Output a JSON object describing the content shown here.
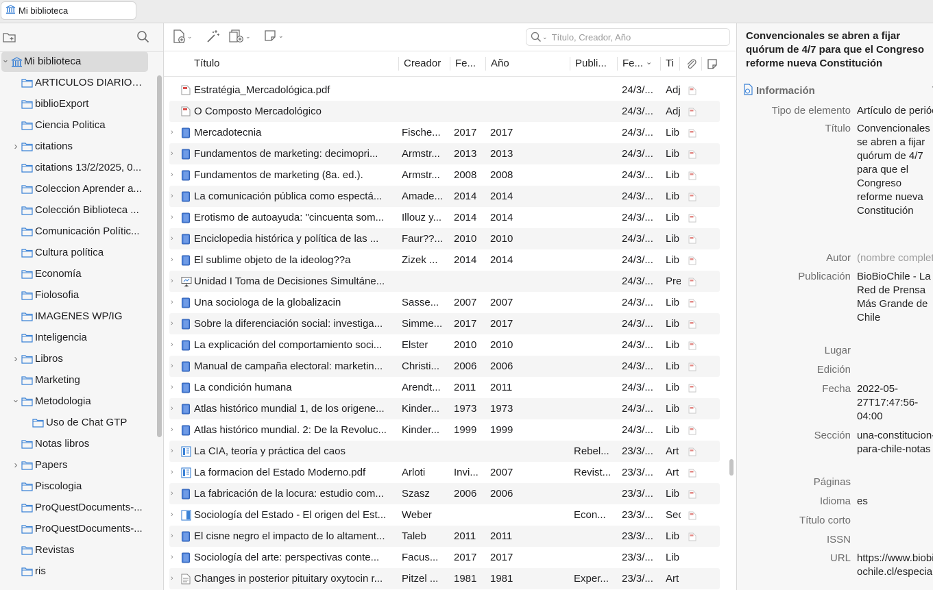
{
  "tab": {
    "title": "Mi biblioteca"
  },
  "left": {
    "items": [
      {
        "label": "Mi biblioteca",
        "kind": "library",
        "expanded": true,
        "selected": true
      },
      {
        "label": "ARTICULOS DIARIOS ...",
        "kind": "folder"
      },
      {
        "label": "biblioExport",
        "kind": "folder"
      },
      {
        "label": "Ciencia Politica",
        "kind": "folder"
      },
      {
        "label": "citations",
        "kind": "folder",
        "collapsed": true
      },
      {
        "label": "citations 13/2/2025, 0...",
        "kind": "folder"
      },
      {
        "label": "Coleccion Aprender a...",
        "kind": "folder"
      },
      {
        "label": "Colección Biblioteca ...",
        "kind": "folder"
      },
      {
        "label": "Comunicación Polític...",
        "kind": "folder"
      },
      {
        "label": "Cultura política",
        "kind": "folder"
      },
      {
        "label": "Economía",
        "kind": "folder"
      },
      {
        "label": "Fiolosofia",
        "kind": "folder"
      },
      {
        "label": "IMAGENES WP/IG",
        "kind": "folder"
      },
      {
        "label": "Inteligencia",
        "kind": "folder"
      },
      {
        "label": "Libros",
        "kind": "folder",
        "collapsed": true
      },
      {
        "label": "Marketing",
        "kind": "folder"
      },
      {
        "label": "Metodologia",
        "kind": "folder",
        "expanded": true
      },
      {
        "label": "Uso de Chat GTP",
        "kind": "folder",
        "child": true
      },
      {
        "label": "Notas libros",
        "kind": "folder"
      },
      {
        "label": "Papers",
        "kind": "folder",
        "collapsed": true
      },
      {
        "label": "Piscologia",
        "kind": "folder"
      },
      {
        "label": "ProQuestDocuments-...",
        "kind": "folder"
      },
      {
        "label": "ProQuestDocuments-...",
        "kind": "folder"
      },
      {
        "label": "Revistas",
        "kind": "folder"
      },
      {
        "label": "ris",
        "kind": "folder"
      }
    ]
  },
  "search": {
    "placeholder": "Título, Creador, Año"
  },
  "columns": {
    "title": "Título",
    "creator": "Creador",
    "fe1": "Fe...",
    "year": "Año",
    "pub": "Publi...",
    "fe2": "Fe...",
    "type": "Ti"
  },
  "rows": [
    {
      "title": "Estratégia_Mercadológica.pdf",
      "creator": "",
      "fe": "",
      "year": "",
      "pub": "",
      "added": "24/3/...",
      "type": "Adj",
      "icon": "pdf",
      "expandable": false,
      "attach": true
    },
    {
      "title": "O Composto Mercadológico",
      "creator": "",
      "fe": "",
      "year": "",
      "pub": "",
      "added": "24/3/...",
      "type": "Adj",
      "icon": "pdf",
      "expandable": false,
      "attach": true
    },
    {
      "title": "Mercadotecnia",
      "creator": "Fische...",
      "fe": "2017",
      "year": "2017",
      "pub": "",
      "added": "24/3/...",
      "type": "Lib",
      "icon": "book",
      "expandable": true,
      "attach": true
    },
    {
      "title": "Fundamentos de marketing: decimopri...",
      "creator": "Armstr...",
      "fe": "2013",
      "year": "2013",
      "pub": "",
      "added": "24/3/...",
      "type": "Lib",
      "icon": "book",
      "expandable": true,
      "attach": true
    },
    {
      "title": "Fundamentos de marketing (8a. ed.).",
      "creator": "Armstr...",
      "fe": "2008",
      "year": "2008",
      "pub": "",
      "added": "24/3/...",
      "type": "Lib",
      "icon": "book",
      "expandable": true,
      "attach": true
    },
    {
      "title": "La comunicación pública como espectá...",
      "creator": "Amade...",
      "fe": "2014",
      "year": "2014",
      "pub": "",
      "added": "24/3/...",
      "type": "Lib",
      "icon": "book",
      "expandable": true,
      "attach": true
    },
    {
      "title": "Erotismo de autoayuda: \"cincuenta som...",
      "creator": "Illouz y...",
      "fe": "2014",
      "year": "2014",
      "pub": "",
      "added": "24/3/...",
      "type": "Lib",
      "icon": "book",
      "expandable": true,
      "attach": true
    },
    {
      "title": "Enciclopedia histórica y política de las ...",
      "creator": "Faur??...",
      "fe": "2010",
      "year": "2010",
      "pub": "",
      "added": "24/3/...",
      "type": "Lib",
      "icon": "book",
      "expandable": true,
      "attach": true
    },
    {
      "title": "El sublime objeto de la ideolog??a",
      "creator": "Zizek ...",
      "fe": "2014",
      "year": "2014",
      "pub": "",
      "added": "24/3/...",
      "type": "Lib",
      "icon": "book",
      "expandable": true,
      "attach": true
    },
    {
      "title": "Unidad I Toma de Decisiones Simultáne...",
      "creator": "",
      "fe": "",
      "year": "",
      "pub": "",
      "added": "24/3/...",
      "type": "Pre",
      "icon": "presentation",
      "expandable": true,
      "attach": true
    },
    {
      "title": "Una sociologa de la globalizacin",
      "creator": "Sasse...",
      "fe": "2007",
      "year": "2007",
      "pub": "",
      "added": "24/3/...",
      "type": "Lib",
      "icon": "book",
      "expandable": true,
      "attach": true
    },
    {
      "title": "Sobre la diferenciación social: investiga...",
      "creator": "Simme...",
      "fe": "2017",
      "year": "2017",
      "pub": "",
      "added": "24/3/...",
      "type": "Lib",
      "icon": "book",
      "expandable": true,
      "attach": true
    },
    {
      "title": "La explicación del comportamiento soci...",
      "creator": "Elster",
      "fe": "2010",
      "year": "2010",
      "pub": "",
      "added": "24/3/...",
      "type": "Lib",
      "icon": "book",
      "expandable": true,
      "attach": true
    },
    {
      "title": "Manual de campaña electoral: marketin...",
      "creator": "Christi...",
      "fe": "2006",
      "year": "2006",
      "pub": "",
      "added": "24/3/...",
      "type": "Lib",
      "icon": "book",
      "expandable": true,
      "attach": true
    },
    {
      "title": "La condición humana",
      "creator": "Arendt...",
      "fe": "2011",
      "year": "2011",
      "pub": "",
      "added": "24/3/...",
      "type": "Lib",
      "icon": "book",
      "expandable": true,
      "attach": true
    },
    {
      "title": "Atlas histórico mundial 1, de los origene...",
      "creator": "Kinder...",
      "fe": "1973",
      "year": "1973",
      "pub": "",
      "added": "24/3/...",
      "type": "Lib",
      "icon": "book",
      "expandable": true,
      "attach": true
    },
    {
      "title": "Atlas histórico mundial. 2: De la Revoluc...",
      "creator": "Kinder...",
      "fe": "1999",
      "year": "1999",
      "pub": "",
      "added": "24/3/...",
      "type": "Lib",
      "icon": "book",
      "expandable": true,
      "attach": true
    },
    {
      "title": "La CIA, teoría y práctica del caos",
      "creator": "",
      "fe": "",
      "year": "",
      "pub": "Rebel...",
      "added": "23/3/...",
      "type": "Art",
      "icon": "journal",
      "expandable": true,
      "attach": true
    },
    {
      "title": "La formacion del Estado Moderno.pdf",
      "creator": "Arloti",
      "fe": "Invi...",
      "year": "2007",
      "pub": "Revist...",
      "added": "23/3/...",
      "type": "Art",
      "icon": "journal",
      "expandable": true,
      "attach": true
    },
    {
      "title": "La fabricación de la locura: estudio com...",
      "creator": "Szasz",
      "fe": "2006",
      "year": "2006",
      "pub": "",
      "added": "23/3/...",
      "type": "Lib",
      "icon": "book",
      "expandable": true,
      "attach": true
    },
    {
      "title": "Sociología del Estado - El origen del Est...",
      "creator": "Weber",
      "fe": "",
      "year": "",
      "pub": "Econ...",
      "added": "23/3/...",
      "type": "Sec",
      "icon": "booksection",
      "expandable": true,
      "attach": true
    },
    {
      "title": "El cisne negro el impacto de lo altament...",
      "creator": "Taleb",
      "fe": "2011",
      "year": "2011",
      "pub": "",
      "added": "23/3/...",
      "type": "Lib",
      "icon": "book",
      "expandable": true,
      "attach": true
    },
    {
      "title": "Sociología del arte: perspectivas conte...",
      "creator": "Facus...",
      "fe": "2017",
      "year": "2017",
      "pub": "",
      "added": "23/3/...",
      "type": "Lib",
      "icon": "book",
      "expandable": true,
      "attach": false
    },
    {
      "title": "Changes in posterior pituitary oxytocin r...",
      "creator": "Pitzel ...",
      "fe": "1981",
      "year": "1981",
      "pub": "Exper...",
      "added": "23/3/...",
      "type": "Art",
      "icon": "doc",
      "expandable": true,
      "attach": false
    }
  ],
  "right": {
    "title": "Convencionales se abren a fijar quórum de 4/7 para que el Congreso reforme nueva Constitución",
    "section": "Información",
    "fields": [
      {
        "label": "Tipo de elemento",
        "value": "Artículo de periódico"
      },
      {
        "label": "Título",
        "value": "Convencionales se abren a fijar quórum de 4/7 para que el Congreso reforme nueva Constitución"
      },
      {
        "label": "Autor",
        "value": "(nombre completo)"
      },
      {
        "label": "Publicación",
        "value": "BioBioChile - La Red de Prensa Más Grande de Chile"
      },
      {
        "label": "Lugar",
        "value": ""
      },
      {
        "label": "Edición",
        "value": ""
      },
      {
        "label": "Fecha",
        "value": "2022-05-27T17:47:56-04:00"
      },
      {
        "label": "Sección",
        "value": "una-constitucion-para-chile-notas"
      },
      {
        "label": "Páginas",
        "value": ""
      },
      {
        "label": "Idioma",
        "value": "es"
      },
      {
        "label": "Título corto",
        "value": ""
      },
      {
        "label": "ISSN",
        "value": ""
      },
      {
        "label": "URL",
        "value": "https://www.biobiochile.cl/especial"
      }
    ]
  },
  "colors": {
    "accent": "#2f6fd6",
    "pdf": "#d9534f",
    "folder": "#3b82d6"
  }
}
